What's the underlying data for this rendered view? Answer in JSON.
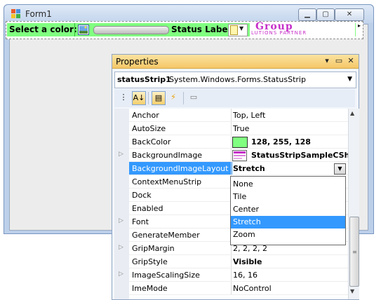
{
  "form": {
    "title": "Form1",
    "controls": {
      "minimize": "▁",
      "maximize": "▢",
      "close": "✕"
    }
  },
  "status_strip": {
    "select_label": "Select a color:",
    "status_label": "Status Label",
    "logo_top": "Group",
    "logo_bottom": "LUTIONS PARTNER",
    "end_arrow": "▸",
    "split_arrow": "▼"
  },
  "properties": {
    "title": "Properties",
    "title_buttons": {
      "dropdown": "▾",
      "restore": "▭",
      "close": "✕"
    },
    "object_name": "statusStrip1",
    "object_type": "System.Windows.Forms.StatusStrip",
    "object_arrow": "▼",
    "toolbar": {
      "categorized": "⋮",
      "alphabetical": "A↓",
      "properties": "▤",
      "events": "⚡",
      "pages": "▭"
    },
    "rows": [
      {
        "name": "Anchor",
        "value": "Top, Left",
        "expandable": false,
        "bold": false
      },
      {
        "name": "AutoSize",
        "value": "True",
        "expandable": false,
        "bold": false
      },
      {
        "name": "BackColor",
        "value": "128, 255, 128",
        "expandable": false,
        "bold": true,
        "swatch": "#80ff80"
      },
      {
        "name": "BackgroundImage",
        "value": "StatusStripSampleCShar",
        "expandable": true,
        "bold": true,
        "image": true
      },
      {
        "name": "BackgroundImageLayout",
        "value": "Stretch",
        "expandable": false,
        "bold": true,
        "selected": true
      },
      {
        "name": "ContextMenuStrip",
        "value": "",
        "expandable": false,
        "bold": false
      },
      {
        "name": "Dock",
        "value": "",
        "expandable": false,
        "bold": false
      },
      {
        "name": "Enabled",
        "value": "",
        "expandable": false,
        "bold": false
      },
      {
        "name": "Font",
        "value": "",
        "expandable": true,
        "bold": false
      },
      {
        "name": "GenerateMember",
        "value": "",
        "expandable": false,
        "bold": false
      },
      {
        "name": "GripMargin",
        "value": "2, 2, 2, 2",
        "expandable": true,
        "bold": false
      },
      {
        "name": "GripStyle",
        "value": "Visible",
        "expandable": false,
        "bold": true
      },
      {
        "name": "ImageScalingSize",
        "value": "16, 16",
        "expandable": true,
        "bold": false
      },
      {
        "name": "ImeMode",
        "value": "NoControl",
        "expandable": false,
        "bold": false
      }
    ],
    "expand_glyph": "▷",
    "combo_arrow": "▼",
    "dropdown_options": [
      "None",
      "Tile",
      "Center",
      "Stretch",
      "Zoom"
    ],
    "dropdown_selected": "Stretch",
    "scroll": {
      "up": "▲",
      "down": "▼",
      "grip": "≡"
    }
  },
  "colors": {
    "strip_bg": "#80ff80",
    "selection": "#3399ff",
    "props_title": "#f5c768"
  }
}
